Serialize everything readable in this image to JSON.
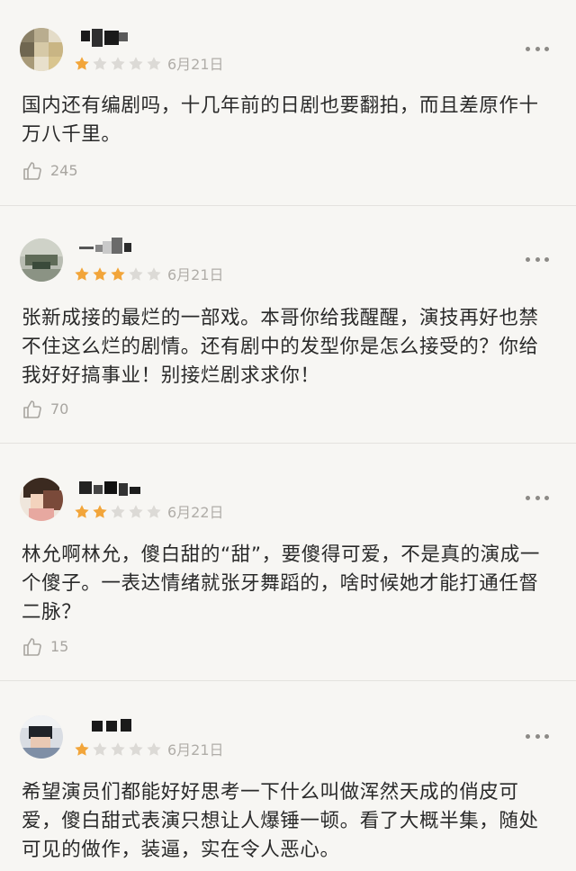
{
  "colors": {
    "star_filled": "#f2a53a",
    "star_empty": "#dcdad6",
    "background": "#f7f6f3",
    "text": "#2a2a2a",
    "muted": "#b0ada8"
  },
  "reviews": [
    {
      "rating": 1,
      "date": "6月21日",
      "text": "国内还有编剧吗，十几年前的日剧也要翻拍，而且差原作十万八千里。",
      "likes": "245"
    },
    {
      "rating": 3,
      "date": "6月21日",
      "text": "张新成接的最烂的一部戏。本哥你给我醒醒，演技再好也禁不住这么烂的剧情。还有剧中的发型你是怎么接受的？你给我好好搞事业！别接烂剧求求你！",
      "likes": "70"
    },
    {
      "rating": 2,
      "date": "6月22日",
      "text": "林允啊林允，傻白甜的“甜”，要傻得可爱，不是真的演成一个傻子。一表达情绪就张牙舞蹈的，啥时候她才能打通任督二脉？",
      "likes": "15"
    },
    {
      "rating": 1,
      "date": "6月21日",
      "text": "希望演员们都能好好思考一下什么叫做浑然天成的俏皮可爱，傻白甜式表演只想让人爆锤一顿。看了大概半集，随处可见的做作，装逼，实在令人恶心。",
      "likes": ""
    }
  ]
}
